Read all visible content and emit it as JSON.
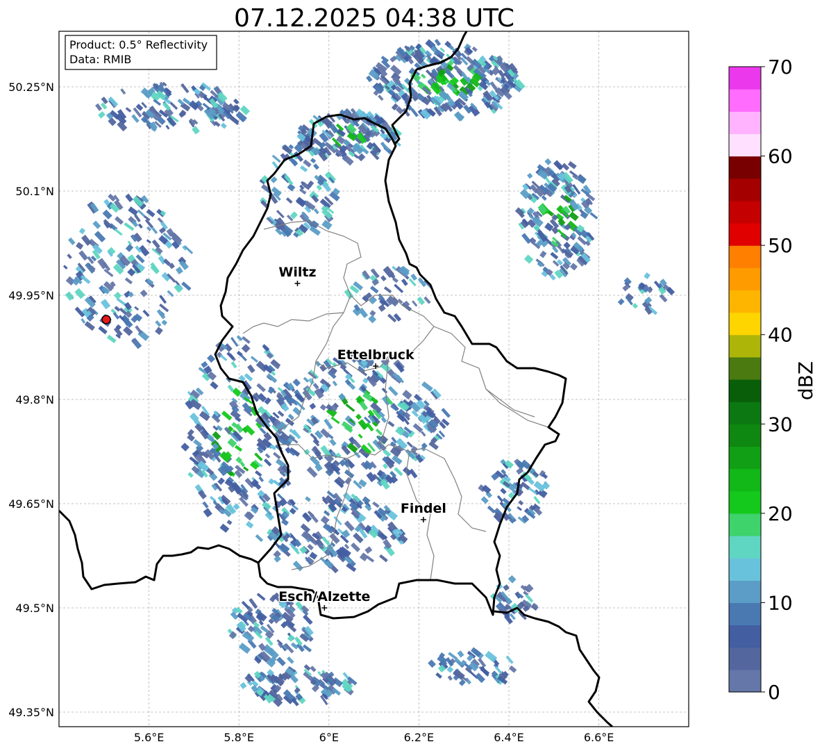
{
  "title": "07.12.2025 04:38 UTC",
  "info_box": {
    "product": "Product: 0.5° Reflectivity",
    "data": "Data: RMIB"
  },
  "map": {
    "lon_range": [
      5.4,
      6.8
    ],
    "lat_range": [
      49.3,
      50.3
    ],
    "x_ticks": [
      {
        "value": 5.6,
        "label": "5.6°E"
      },
      {
        "value": 5.8,
        "label": "5.8°E"
      },
      {
        "value": 6.0,
        "label": "6°E"
      },
      {
        "value": 6.2,
        "label": "6.2°E"
      },
      {
        "value": 6.4,
        "label": "6.4°E"
      },
      {
        "value": 6.6,
        "label": "6.6°E"
      }
    ],
    "y_ticks": [
      {
        "value": 50.25,
        "label": "50.25°N"
      },
      {
        "value": 50.1,
        "label": "50.1°N"
      },
      {
        "value": 49.95,
        "label": "49.95°N"
      },
      {
        "value": 49.8,
        "label": "49.8°N"
      },
      {
        "value": 49.65,
        "label": "49.65°N"
      },
      {
        "value": 49.5,
        "label": "49.5°N"
      },
      {
        "value": 49.35,
        "label": "49.35°N"
      }
    ],
    "gridlines": true,
    "cities": [
      {
        "name": "Wiltz",
        "lon": 5.93,
        "lat": 49.967
      },
      {
        "name": "Ettelbruck",
        "lon": 6.104,
        "lat": 49.848
      },
      {
        "name": "Findel",
        "lon": 6.21,
        "lat": 49.627
      },
      {
        "name": "Esch/Alzette",
        "lon": 5.99,
        "lat": 49.5
      }
    ],
    "radar_site": {
      "lon": 5.505,
      "lat": 49.915,
      "color": "#e8191a"
    },
    "border_color": "#000000",
    "canton_color": "#808080"
  },
  "colorbar": {
    "label": "dBZ",
    "min": 0,
    "max": 70,
    "ticks": [
      "0",
      "10",
      "20",
      "30",
      "40",
      "50",
      "60",
      "70"
    ],
    "colors": [
      "#6577a9",
      "#53669e",
      "#435ea1",
      "#4a79b2",
      "#5b9dc6",
      "#69c2dc",
      "#5fd6c2",
      "#3fd36c",
      "#14c91c",
      "#12b817",
      "#119f15",
      "#0e8810",
      "#0c7812",
      "#095e09",
      "#4a7a10",
      "#adb509",
      "#ffd500",
      "#fdb500",
      "#fe9b00",
      "#ff7f00",
      "#e10000",
      "#c40000",
      "#a50000",
      "#790000",
      "#ffe0ff",
      "#ffb3ff",
      "#ff6cfe",
      "#ec38ec"
    ]
  }
}
